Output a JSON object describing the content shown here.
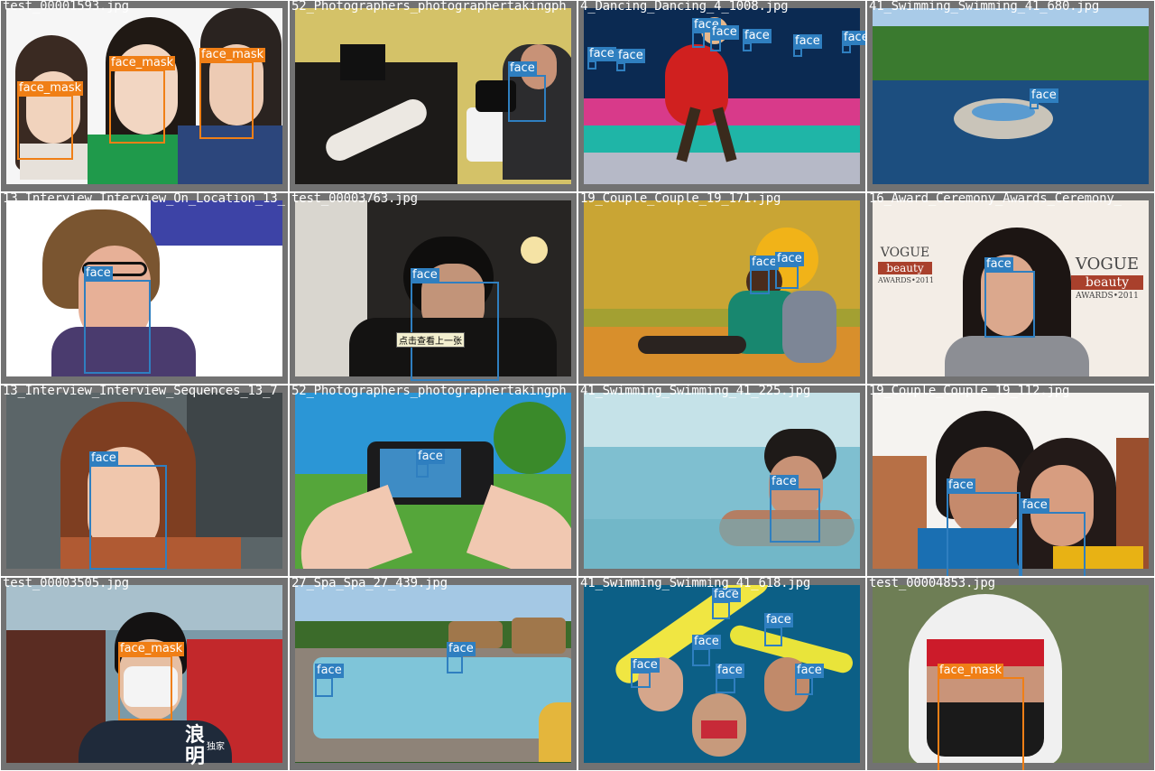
{
  "tiles": [
    {
      "filename": "test_00001593.jpg",
      "labels": [
        "face_mask",
        "face_mask",
        "face_mask"
      ]
    },
    {
      "filename": "52_Photographers_photographertakingph",
      "labels": [
        "face"
      ]
    },
    {
      "filename": "4_Dancing_Dancing_4_1008.jpg",
      "labels": [
        "face",
        "face",
        "face",
        "face",
        "face",
        "face",
        "face"
      ]
    },
    {
      "filename": "41_Swimming_Swimming_41_680.jpg",
      "labels": [
        "face"
      ]
    },
    {
      "filename": "13_Interview_Interview_On_Location_13_",
      "labels": [
        "face"
      ]
    },
    {
      "filename": "test_00003763.jpg",
      "labels": [
        "face"
      ],
      "overlay": "点击查看上一张"
    },
    {
      "filename": "19_Couple_Couple_19_171.jpg",
      "labels": [
        "face",
        "face"
      ]
    },
    {
      "filename": "16_Award_Ceremony_Awards_Ceremony_",
      "labels": [
        "face"
      ],
      "backdrop": [
        "VOGUE",
        "beauty",
        "AWARDS•2011"
      ]
    },
    {
      "filename": "13_Interview_Interview_Sequences_13_7",
      "labels": [
        "face"
      ]
    },
    {
      "filename": "52_Photographers_photographertakingph",
      "labels": [
        "face"
      ]
    },
    {
      "filename": "41_Swimming_Swimming_41_225.jpg",
      "labels": [
        "face"
      ]
    },
    {
      "filename": "19_Couple_Couple_19_112.jpg",
      "labels": [
        "face",
        "face"
      ]
    },
    {
      "filename": "test_00003505.jpg",
      "labels": [
        "face_mask"
      ],
      "logo": [
        "浪",
        "明",
        "独家"
      ]
    },
    {
      "filename": "27_Spa_Spa_27_439.jpg",
      "labels": [
        "face",
        "face"
      ]
    },
    {
      "filename": "41_Swimming_Swimming_41_618.jpg",
      "labels": [
        "face",
        "face",
        "face",
        "face",
        "face",
        "face"
      ]
    },
    {
      "filename": "test_00004853.jpg",
      "labels": [
        "face_mask"
      ]
    }
  ],
  "colors": {
    "face": "#2f7fc0",
    "face_mask": "#f07f16",
    "tile_border": "#727272"
  }
}
